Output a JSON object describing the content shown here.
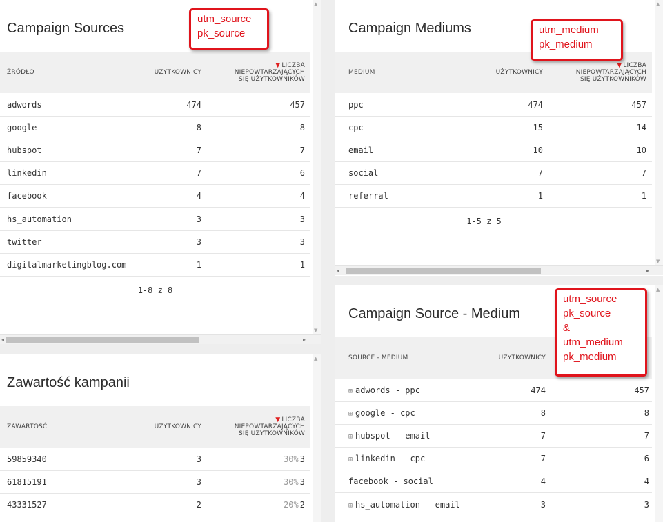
{
  "widgets": {
    "sources": {
      "title": "Campaign Sources",
      "headers": {
        "col1": "ŹRÓDŁO",
        "col2": "UŻYTKOWNICY",
        "col3_l1": "LICZBA",
        "col3_l2": "NIEPOWTARZAJĄCYCH",
        "col3_l3": "SIĘ UŻYTKOWNIKÓW"
      },
      "rows": [
        {
          "label": "adwords",
          "users": "474",
          "unique": "457"
        },
        {
          "label": "google",
          "users": "8",
          "unique": "8"
        },
        {
          "label": "hubspot",
          "users": "7",
          "unique": "7"
        },
        {
          "label": "linkedin",
          "users": "7",
          "unique": "6"
        },
        {
          "label": "facebook",
          "users": "4",
          "unique": "4"
        },
        {
          "label": "hs_automation",
          "users": "3",
          "unique": "3"
        },
        {
          "label": "twitter",
          "users": "3",
          "unique": "3"
        },
        {
          "label": "digitalmarketingblog.com",
          "users": "1",
          "unique": "1"
        }
      ],
      "pager": "1-8 z 8"
    },
    "mediums": {
      "title": "Campaign Mediums",
      "headers": {
        "col1": "MEDIUM",
        "col2": "UŻYTKOWNICY",
        "col3_l1": "LICZBA",
        "col3_l2": "NIEPOWTARZAJĄCYCH",
        "col3_l3": "SIĘ UŻYTKOWNIKÓW"
      },
      "rows": [
        {
          "label": "ppc",
          "users": "474",
          "unique": "457"
        },
        {
          "label": "cpc",
          "users": "15",
          "unique": "14"
        },
        {
          "label": "email",
          "users": "10",
          "unique": "10"
        },
        {
          "label": "social",
          "users": "7",
          "unique": "7"
        },
        {
          "label": "referral",
          "users": "1",
          "unique": "1"
        }
      ],
      "pager": "1-5 z 5"
    },
    "content": {
      "title": "Zawartość kampanii",
      "headers": {
        "col1": "ZAWARTOŚĆ",
        "col2": "UŻYTKOWNICY",
        "col3_l1": "LICZBA",
        "col3_l2": "NIEPOWTARZAJĄCYCH",
        "col3_l3": "SIĘ UŻYTKOWNIKÓW"
      },
      "rows": [
        {
          "label": "59859340",
          "users": "3",
          "pct": "30%",
          "unique": "3"
        },
        {
          "label": "61815191",
          "users": "3",
          "pct": "30%",
          "unique": "3"
        },
        {
          "label": "43331527",
          "users": "2",
          "pct": "20%",
          "unique": "2"
        }
      ]
    },
    "source_medium": {
      "title": "Campaign Source - Medium",
      "headers": {
        "col1": "SOURCE - MEDIUM",
        "col2": "UŻYTKOWNICY"
      },
      "rows": [
        {
          "expand": "⊞",
          "label": "adwords - ppc",
          "users": "474",
          "unique": "457"
        },
        {
          "expand": "⊞",
          "label": "google - cpc",
          "users": "8",
          "unique": "8"
        },
        {
          "expand": "⊞",
          "label": "hubspot - email",
          "users": "7",
          "unique": "7"
        },
        {
          "expand": "⊞",
          "label": "linkedin - cpc",
          "users": "7",
          "unique": "6"
        },
        {
          "expand": "",
          "label": "facebook - social",
          "users": "4",
          "unique": "4"
        },
        {
          "expand": "⊞",
          "label": "hs_automation - email",
          "users": "3",
          "unique": "3"
        }
      ]
    }
  },
  "callouts": {
    "sources": [
      "utm_source",
      "pk_source"
    ],
    "mediums": [
      "utm_medium",
      "pk_medium"
    ],
    "source_medium": [
      "utm_source",
      "pk_source",
      "&",
      "utm_medium",
      "pk_medium"
    ]
  },
  "sort_indicator": "▼",
  "colors": {
    "callout": "#e0141c",
    "sort_arrow": "#e02020",
    "header_bg": "#f0f0f0"
  }
}
